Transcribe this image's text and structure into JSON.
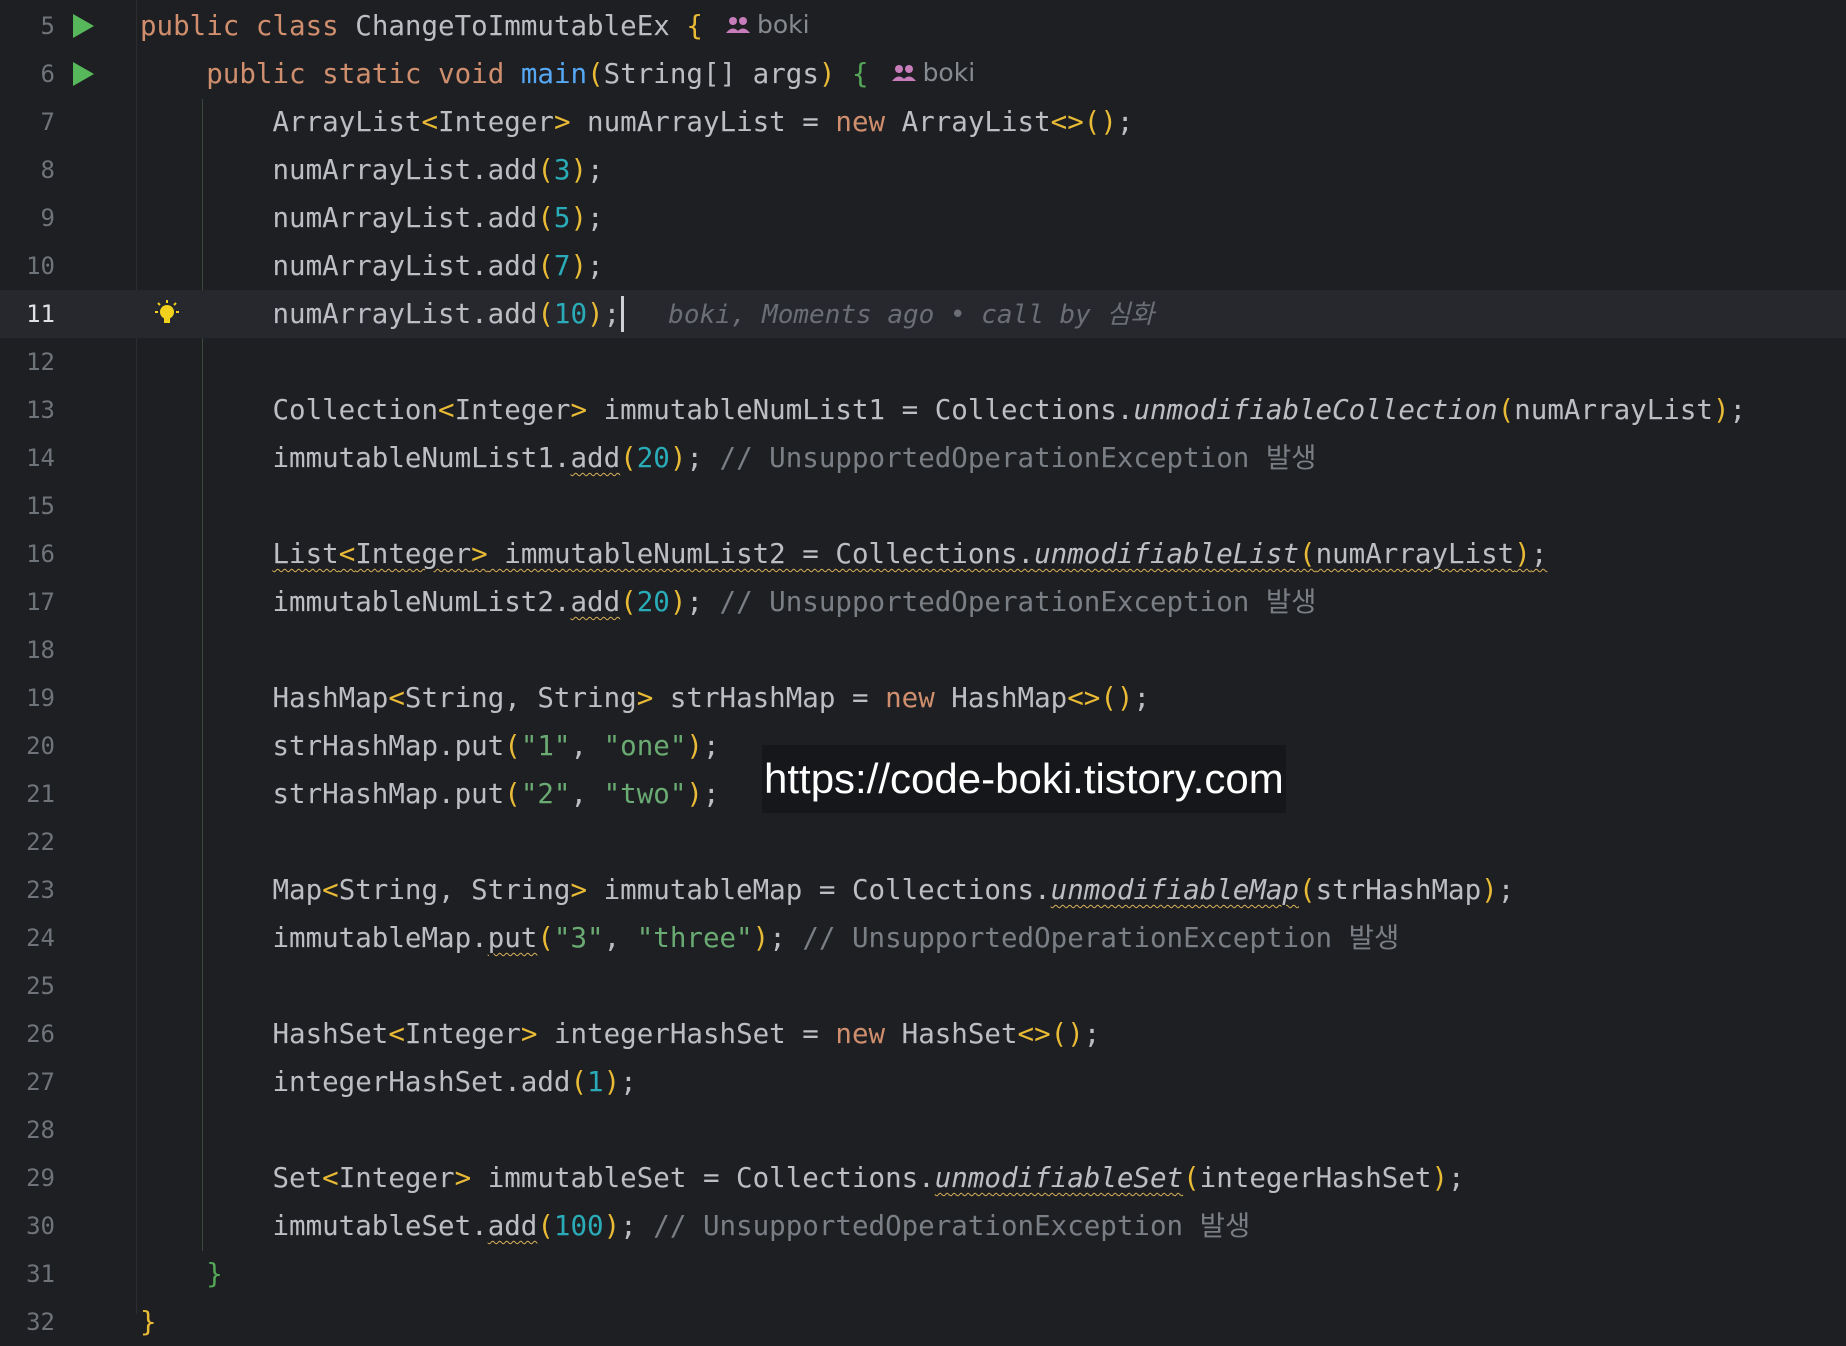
{
  "editor": {
    "author": "boki",
    "blame": "boki, Moments ago • call by 심화",
    "watermark": "https://code-boki.tistory.com",
    "lines": [
      {
        "n": "5"
      },
      {
        "n": "6"
      },
      {
        "n": "7"
      },
      {
        "n": "8"
      },
      {
        "n": "9"
      },
      {
        "n": "10"
      },
      {
        "n": "11"
      },
      {
        "n": "12"
      },
      {
        "n": "13"
      },
      {
        "n": "14"
      },
      {
        "n": "15"
      },
      {
        "n": "16"
      },
      {
        "n": "17"
      },
      {
        "n": "18"
      },
      {
        "n": "19"
      },
      {
        "n": "20"
      },
      {
        "n": "21"
      },
      {
        "n": "22"
      },
      {
        "n": "23"
      },
      {
        "n": "24"
      },
      {
        "n": "25"
      },
      {
        "n": "26"
      },
      {
        "n": "27"
      },
      {
        "n": "28"
      },
      {
        "n": "29"
      },
      {
        "n": "30"
      },
      {
        "n": "31"
      },
      {
        "n": "32"
      }
    ],
    "tokens": {
      "kw_public": "public",
      "kw_class": "class",
      "kw_static": "static",
      "kw_void": "void",
      "kw_new": "new",
      "cls_name": "ChangeToImmutableEx",
      "fn_main": "main",
      "open_brace": "{",
      "close_brace": "}",
      "main_params_open": "(",
      "main_params": "String[] args",
      "main_params_close": ")",
      "l7_a": "ArrayList",
      "l7_b": "<",
      "l7_c": "Integer",
      "l7_d": ">",
      " l7_e": " numArrayList = ",
      "l7_e": " numArrayList = ",
      "l7_f": " ArrayList",
      "l7_g": "<>",
      "l7_h": "()",
      "semi": ";",
      "add_prefix": "numArrayList.add",
      "lp": "(",
      "rp": ")",
      "n3": "3",
      "n5": "5",
      "n7": "7",
      "n10": "10",
      "n20": "20",
      "n1": "1",
      "n100": "100",
      "l13_a": "Collection",
      "l13_c": "Integer",
      "l13_e": " immutableNumList1 = Collections.",
      "l13_f": "unmodifiableCollection",
      "arg_num": "numArrayList",
      "l14_a": "immutableNumList1.",
      "add": "add",
      "comment": "// UnsupportedOperationException 발생",
      "l16_a": "List",
      "l16_e": " immutableNumList2 = Collections.",
      "l16_f": "unmodifiableList",
      "l17_a": "immutableNumList2.",
      "l19_a": "HashMap",
      "l19_c": "String, String",
      "l19_e": " strHashMap = ",
      "l19_f": " HashMap",
      "put_prefix": "strHashMap.put",
      "comma": ", ",
      "s1": "\"1\"",
      "sone": "\"one\"",
      "s2": "\"2\"",
      "stwo": "\"two\"",
      "s3": "\"3\"",
      "sthree": "\"three\"",
      "l23_a": "Map",
      "l23_e": " immutableMap = Collections.",
      "l23_f": "unmodifiableMap",
      "arg_map": "strHashMap",
      "l24_a": "immutableMap.",
      "put": "put",
      "l26_a": "HashSet",
      "l26_e": " integerHashSet = ",
      "l26_f": " HashSet",
      "l27_a": "integerHashSet.add",
      "l29_a": "Set",
      "l29_e": " immutableSet = Collections.",
      "l29_f": "unmodifiableSet",
      "arg_set": "integerHashSet",
      "l30_a": "immutableSet."
    }
  }
}
